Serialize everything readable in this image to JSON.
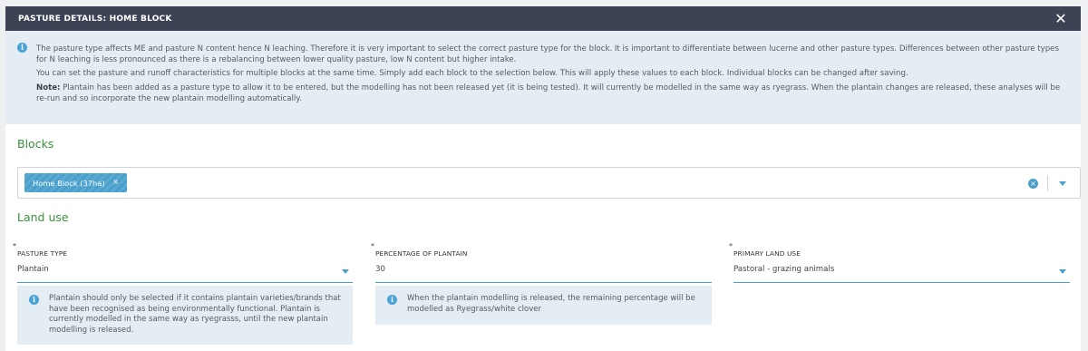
{
  "modal": {
    "title": "PASTURE DETAILS: HOME BLOCK",
    "close_icon": "close-icon"
  },
  "info": {
    "p1": "The pasture type affects ME and pasture N content hence N leaching. Therefore it is very important to select the correct pasture type for the block. It is important to differentiate between lucerne and other pasture types. Differences between other pasture types for N leaching is less pronounced as there is a rebalancing between lower quality pasture, low N content but higher intake.",
    "p2": "You can set the pasture and runoff characteristics for multiple blocks at the same time. Simply add each block to the selection below. This will apply these values to each block. Individual blocks can be changed after saving.",
    "note_label": "Note:",
    "note_text": " Plantain has been added as a pasture type to allow it to be entered, but the modelling has not been released yet (it is being tested). It will currently be modelled in the same way as ryegrass. When the plantain changes are released, these analyses will be re-run and so incorporate the new plantain modelling automatically."
  },
  "blocks": {
    "title": "Blocks",
    "selected": [
      "Home Block (37ha)"
    ],
    "chip_remove": "×"
  },
  "land_use": {
    "title": "Land use",
    "pasture_type": {
      "label": "PASTURE TYPE",
      "value": "Plantain",
      "hint": "Plantain should only be selected if it contains plantain varieties/brands that have been recognised as being environmentally functional. Plantain is currently modelled in the same way as ryegrasss, until the new plantain modelling is released."
    },
    "percentage_plantain": {
      "label": "PERCENTAGE OF PLANTAIN",
      "value": "30",
      "hint": "When the plantain modelling is released, the remaining percentage will be modelled as Ryegrass/white clover"
    },
    "primary_land_use": {
      "label": "PRIMARY LAND USE",
      "value": "Pastoral - grazing animals"
    },
    "required_marker": "*"
  },
  "colors": {
    "header_bg": "#3c4354",
    "accent": "#4a9fcb",
    "section_title": "#3c8f3c",
    "info_bg": "#e4edf3"
  }
}
